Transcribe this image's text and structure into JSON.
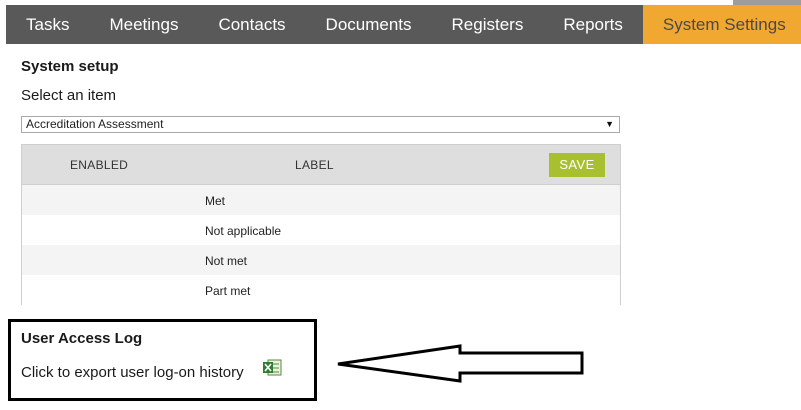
{
  "nav": {
    "tabs": [
      {
        "label": "Tasks"
      },
      {
        "label": "Meetings"
      },
      {
        "label": "Contacts"
      },
      {
        "label": "Documents"
      },
      {
        "label": "Registers"
      },
      {
        "label": "Reports"
      },
      {
        "label": "System Settings",
        "active": true
      }
    ],
    "active_color": "#f0a830",
    "bar_color": "#595959"
  },
  "system_setup": {
    "title": "System setup",
    "select_label": "Select an item",
    "selected_item": "Accreditation Assessment"
  },
  "table": {
    "headers": {
      "enabled": "ENABLED",
      "label": "LABEL"
    },
    "save_label": "SAVE",
    "save_color": "#a8c030",
    "rows": [
      {
        "label": "Met"
      },
      {
        "label": "Not applicable"
      },
      {
        "label": "Not met"
      },
      {
        "label": "Part met"
      }
    ]
  },
  "user_access_log": {
    "title": "User Access Log",
    "export_text": "Click to export user log-on history",
    "export_icon": "excel-icon"
  }
}
